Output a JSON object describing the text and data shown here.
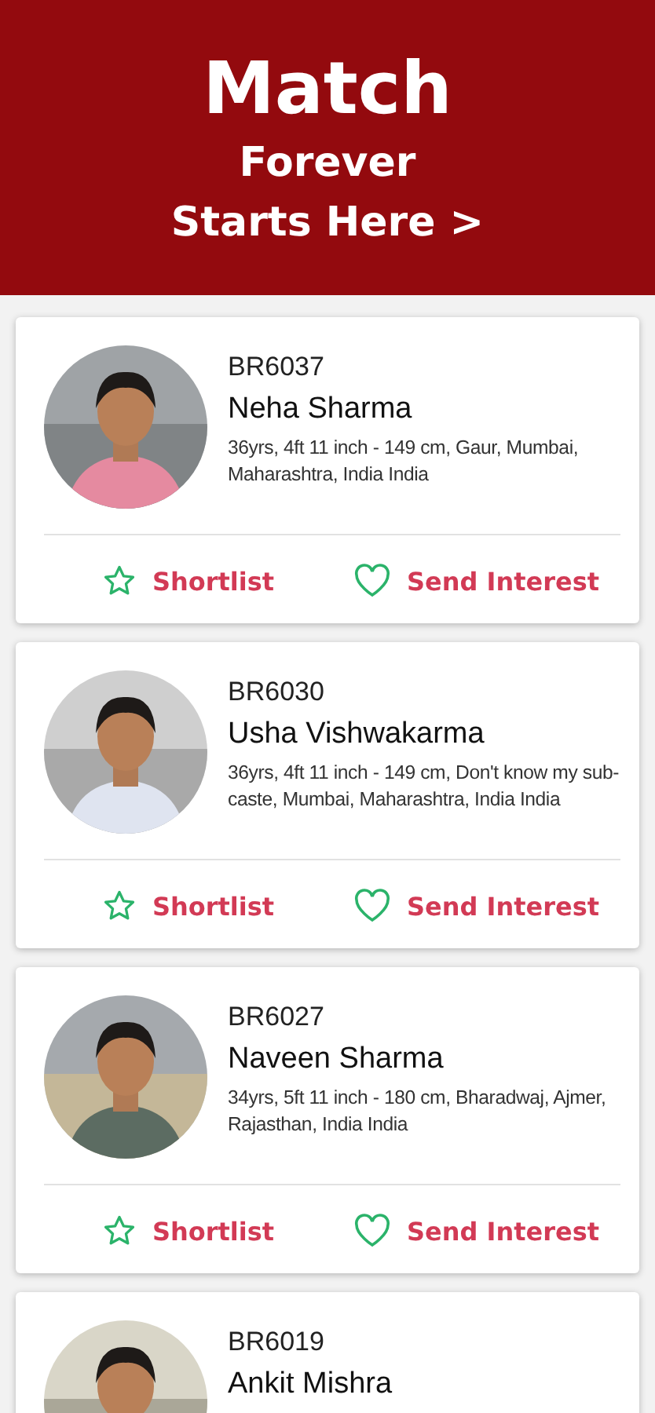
{
  "banner": {
    "title": "Match",
    "subtitle": "Forever",
    "link": "Starts Here >"
  },
  "profiles": [
    {
      "id": "BR6037",
      "name": "Neha Sharma",
      "details": "36yrs, 4ft 11 inch - 149 cm, Gaur, Mumbai, Maharashtra, India India",
      "actions": [
        {
          "kind": "shortlist",
          "label": "Shortlist"
        },
        {
          "kind": "interest",
          "label": "Send Interest"
        }
      ]
    },
    {
      "id": "BR6030",
      "name": "Usha Vishwakarma",
      "details": "36yrs, 4ft 11 inch - 149 cm, Don't know my sub-caste, Mumbai, Maharashtra, India India",
      "actions": [
        {
          "kind": "shortlist",
          "label": "Shortlist"
        },
        {
          "kind": "interest",
          "label": "Send Interest"
        }
      ]
    },
    {
      "id": "BR6027",
      "name": "Naveen Sharma",
      "details": "34yrs, 5ft 11 inch - 180 cm, Bharadwaj, Ajmer, Rajasthan, India India",
      "actions": [
        {
          "kind": "shortlist",
          "label": "Shortlist"
        },
        {
          "kind": "interest",
          "label": "Send Interest"
        }
      ]
    },
    {
      "id": "BR6019",
      "name": "Ankit Mishra"
    }
  ]
}
